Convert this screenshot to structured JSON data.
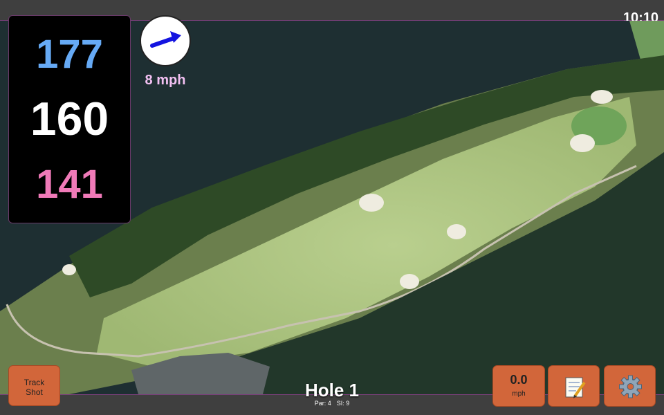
{
  "status_bar": {
    "time": "10:10"
  },
  "distances": {
    "back": "177",
    "middle": "160",
    "front": "141"
  },
  "wind": {
    "speed_label": "8 mph",
    "icon": "wind-direction-arrow-icon"
  },
  "hole": {
    "title": "Hole 1",
    "par_label": "Par: 4",
    "si_label": "SI: 9"
  },
  "buttons": {
    "track_shot_line1": "Track",
    "track_shot_line2": "Shot",
    "speed_value": "0.0",
    "speed_unit": "mph",
    "notes_icon": "notepad-icon",
    "settings_icon": "gear-icon"
  },
  "colors": {
    "back_distance": "#66aaf5",
    "middle_distance": "#ffffff",
    "front_distance": "#f07ab8",
    "button": "#d2663a",
    "accent_border": "#7a3f7a"
  }
}
